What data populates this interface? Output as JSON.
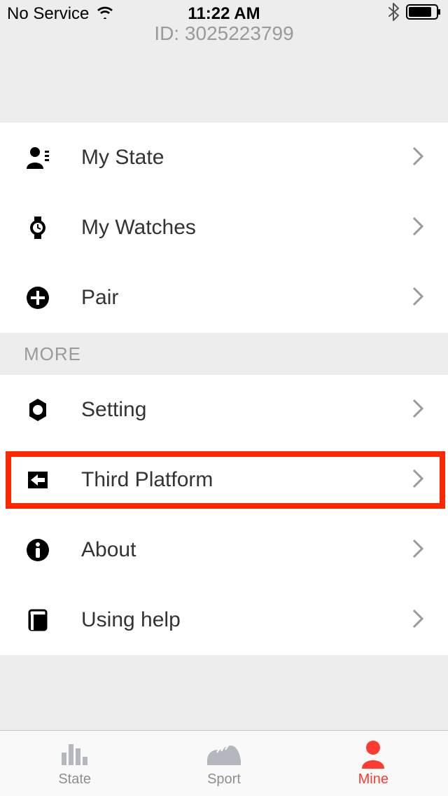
{
  "status": {
    "carrier": "No Service",
    "time": "11:22 AM"
  },
  "header": {
    "id_label": "ID: 3025223799"
  },
  "section1": {
    "items": [
      {
        "label": "My State"
      },
      {
        "label": "My Watches"
      },
      {
        "label": "Pair"
      }
    ]
  },
  "more_label": "MORE",
  "section2": {
    "items": [
      {
        "label": "Setting"
      },
      {
        "label": "Third Platform"
      },
      {
        "label": "About"
      },
      {
        "label": "Using help"
      }
    ]
  },
  "tabs": {
    "state": "State",
    "sport": "Sport",
    "mine": "Mine"
  }
}
